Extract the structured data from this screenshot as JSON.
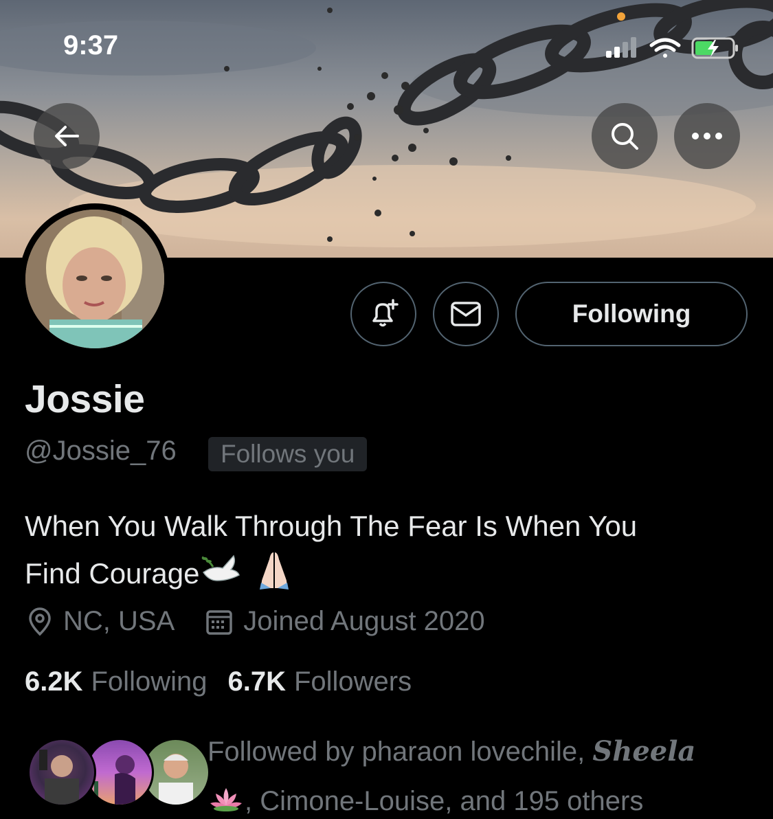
{
  "status_bar": {
    "time": "9:37"
  },
  "banner": {
    "description_icon": "broken-chain-banner"
  },
  "nav": {
    "back_icon": "arrow-left-icon",
    "search_icon": "search-icon",
    "more_icon": "more-horizontal-icon"
  },
  "profile": {
    "display_name": "Jossie",
    "handle": "@Jossie_76",
    "follows_you_badge": "Follows you",
    "bio_text_line1": "When You Walk Through The Fear Is When You",
    "bio_text_line2": "Find Courage",
    "location": "NC, USA",
    "joined": "Joined August 2020"
  },
  "actions": {
    "notify_icon": "bell-plus-icon",
    "message_icon": "envelope-icon",
    "following_label": "Following"
  },
  "stats": {
    "following_count": "6.2K",
    "following_label": "Following",
    "followers_count": "6.7K",
    "followers_label": "Followers"
  },
  "followed_by": {
    "prefix": "Followed by pharaon lovechile, ",
    "styled_name": "Sheela",
    "suffix": ", Cimone-Louise, and 195 others"
  },
  "colors": {
    "background": "#000000",
    "primary_text": "#e7e9ea",
    "secondary_text": "#71767b",
    "border": "#536471"
  }
}
